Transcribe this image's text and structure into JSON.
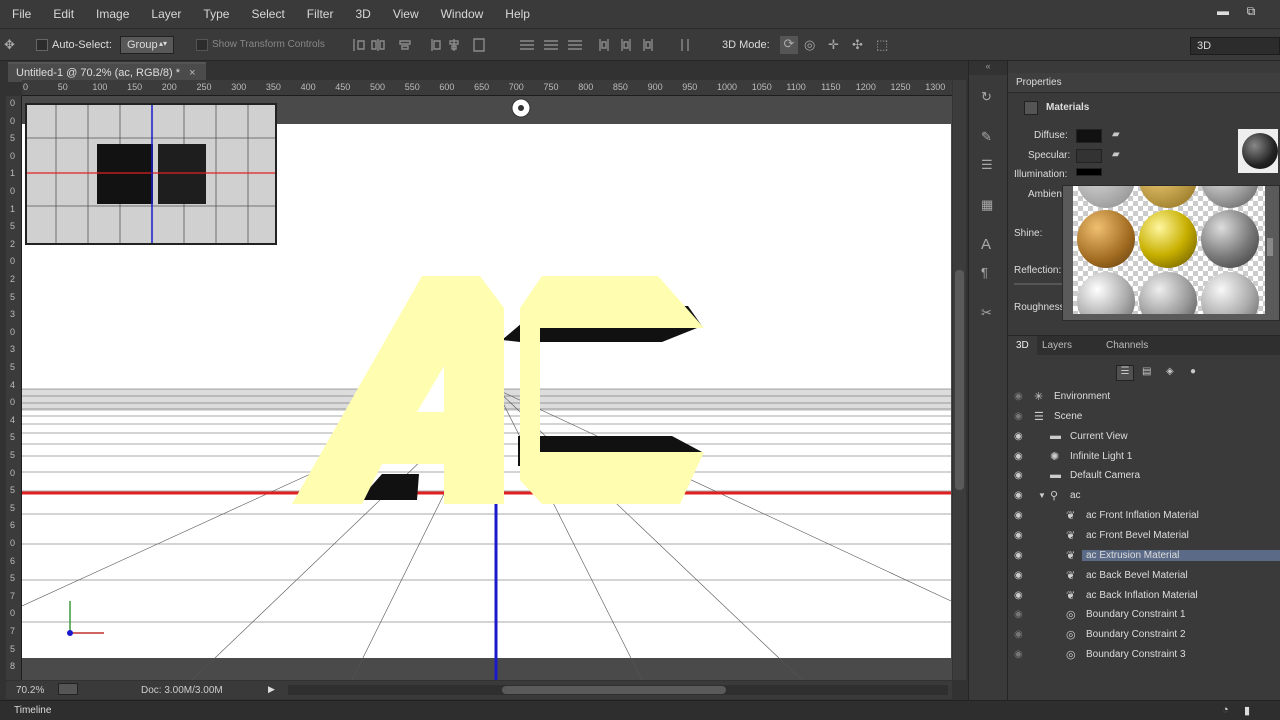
{
  "menu": [
    "File",
    "Edit",
    "Image",
    "Layer",
    "Type",
    "Select",
    "Filter",
    "3D",
    "View",
    "Window",
    "Help"
  ],
  "window_controls": {
    "minimize": "▬",
    "restore": "⧉"
  },
  "options": {
    "auto_select_label": "Auto-Select:",
    "auto_select_value": "Group",
    "show_transform": "Show Transform Controls",
    "mode_label": "3D Mode:",
    "workspace": "3D"
  },
  "document": {
    "tab_title": "Untitled-1 @ 70.2% (ac, RGB/8) *",
    "close": "×",
    "zoom": "70.2%",
    "doc_info": "Doc: 3.00M/3.00M"
  },
  "ruler_h": [
    "0",
    "50",
    "100",
    "150",
    "200",
    "250",
    "300",
    "350",
    "400",
    "450",
    "500",
    "550",
    "600",
    "650",
    "700",
    "750",
    "800",
    "850",
    "900",
    "950",
    "1000",
    "1050",
    "1100",
    "1150",
    "1200",
    "1250",
    "1300"
  ],
  "ruler_v": [
    "0",
    "0",
    "5",
    "0",
    "1",
    "0",
    "1",
    "5",
    "2",
    "0",
    "2",
    "5",
    "3",
    "0",
    "3",
    "5",
    "4",
    "0",
    "4",
    "5",
    "5",
    "0",
    "5",
    "5",
    "6",
    "0",
    "6",
    "5",
    "7",
    "0",
    "7",
    "5",
    "8"
  ],
  "timeline": {
    "label": "Timeline"
  },
  "properties": {
    "tab": "Properties",
    "section": "Materials",
    "labels": {
      "diffuse": "Diffuse:",
      "specular": "Specular:",
      "illumination": "Illumination:",
      "ambient": "Ambient:",
      "shine": "Shine:",
      "reflection": "Reflection:",
      "roughness": "Roughness:"
    },
    "colors": {
      "diffuse": "#111111",
      "specular": "#333333",
      "illumination": "#000000"
    }
  },
  "panel_tabs": [
    "3D",
    "Layers",
    "Channels"
  ],
  "scene_items": [
    {
      "label": "Environment",
      "icon": "environment-icon",
      "level": 0
    },
    {
      "label": "Scene",
      "icon": "scene-icon",
      "level": 0
    },
    {
      "label": "Current View",
      "icon": "camera-icon",
      "level": 1
    },
    {
      "label": "Infinite Light 1",
      "icon": "light-icon",
      "level": 1
    },
    {
      "label": "Default Camera",
      "icon": "camera-icon",
      "level": 1
    },
    {
      "label": "ac",
      "icon": "mesh-icon",
      "level": 1
    },
    {
      "label": "ac Front Inflation Material",
      "icon": "material-icon",
      "level": 2
    },
    {
      "label": "ac Front Bevel Material",
      "icon": "material-icon",
      "level": 2
    },
    {
      "label": "ac Extrusion Material",
      "icon": "material-icon",
      "level": 2,
      "selected": true
    },
    {
      "label": "ac Back Bevel Material",
      "icon": "material-icon",
      "level": 2
    },
    {
      "label": "ac Back Inflation Material",
      "icon": "material-icon",
      "level": 2
    },
    {
      "label": "Boundary Constraint 1",
      "icon": "constraint-icon",
      "level": 2
    },
    {
      "label": "Boundary Constraint 2",
      "icon": "constraint-icon",
      "level": 2
    },
    {
      "label": "Boundary Constraint 3",
      "icon": "constraint-icon",
      "level": 2
    }
  ],
  "scene_text": {
    "letters": "ac",
    "letter_color": "#fffdb0"
  }
}
